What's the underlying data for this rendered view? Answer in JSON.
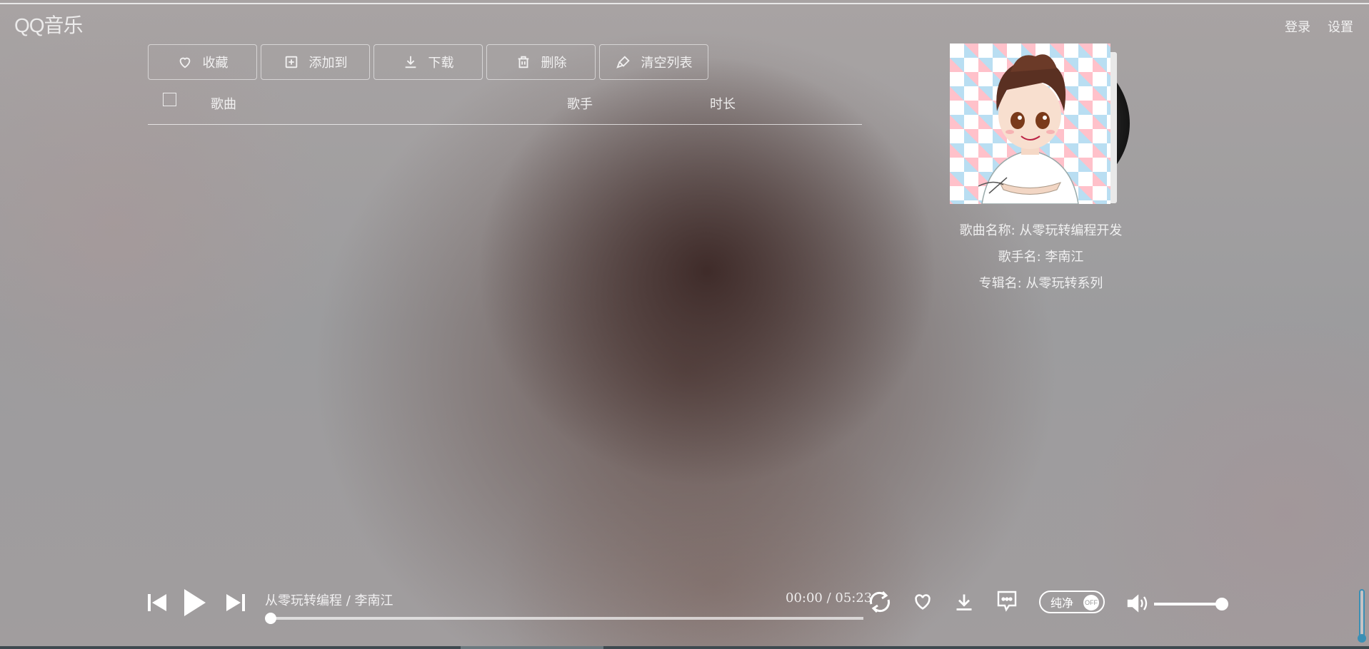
{
  "app": {
    "logo": "QQ音乐"
  },
  "topnav": {
    "login": "登录",
    "settings": "设置"
  },
  "toolbar": {
    "favorite": "收藏",
    "add_to": "添加到",
    "download": "下载",
    "delete": "删除",
    "clear_list": "清空列表"
  },
  "list_header": {
    "song": "歌曲",
    "artist": "歌手",
    "duration": "时长"
  },
  "song_info": {
    "name": "歌曲名称: 从零玩转编程开发",
    "artist": "歌手名: 李南江",
    "album": "专辑名: 从零玩转系列"
  },
  "player": {
    "now_playing": "从零玩转编程 / 李南江",
    "time": "00:00 / 05:23",
    "progress": 0,
    "pure_label": "纯净",
    "pure_state": "OFF",
    "volume": 1.0
  },
  "colors": {
    "accent_scroll": "#3a8fb5",
    "text": "#ffffff"
  }
}
